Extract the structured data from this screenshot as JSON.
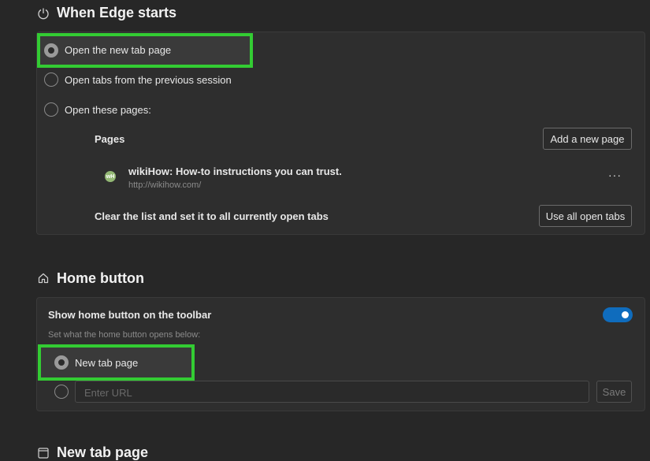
{
  "startup": {
    "title": "When Edge starts",
    "options": [
      {
        "label": "Open the new tab page",
        "selected": true
      },
      {
        "label": "Open tabs from the previous session",
        "selected": false
      },
      {
        "label": "Open these pages:",
        "selected": false
      }
    ],
    "pages_heading": "Pages",
    "add_page_label": "Add a new page",
    "page_entry": {
      "favicon_text": "wH",
      "title": "wikiHow: How-to instructions you can trust.",
      "url": "http://wikihow.com/",
      "more_label": "···"
    },
    "clear_text": "Clear the list and set it to all currently open tabs",
    "use_open_tabs_label": "Use all open tabs"
  },
  "home": {
    "title": "Home button",
    "show_label": "Show home button on the toolbar",
    "toggle_on": true,
    "hint": "Set what the home button opens below:",
    "option_new_tab": "New tab page",
    "url_placeholder": "Enter URL",
    "save_label": "Save"
  },
  "newtab": {
    "title": "New tab page"
  },
  "colors": {
    "background": "#272727",
    "card": "#2e2e2e",
    "highlight": "#33cc33",
    "toggle": "#0f6cbd"
  }
}
